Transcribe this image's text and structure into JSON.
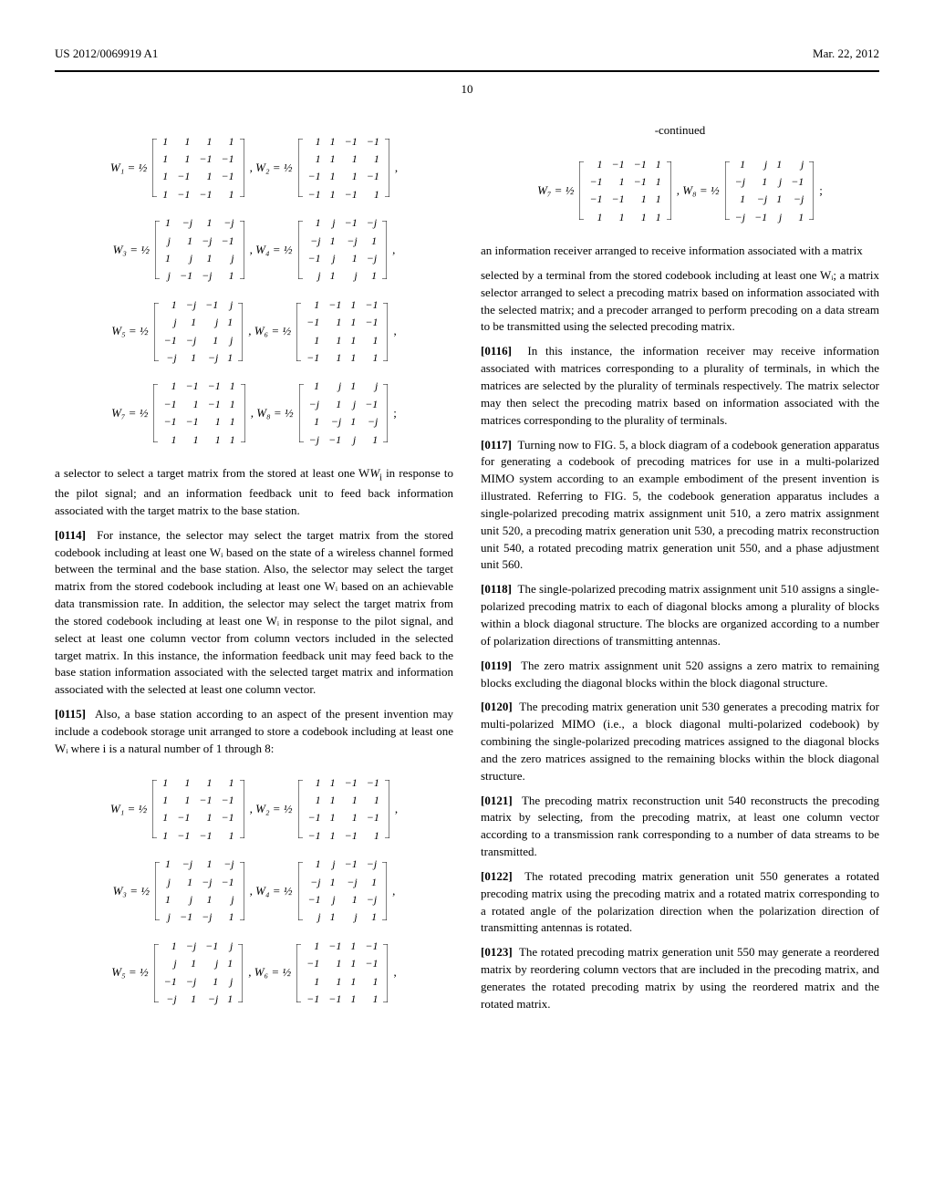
{
  "header": {
    "left": "US 2012/0069919 A1",
    "right": "Mar. 22, 2012",
    "page_number": "10"
  },
  "matrices_col1_top": [
    {
      "label": "W₁ = ½",
      "cells": [
        [
          "1",
          "1",
          "1",
          "1"
        ],
        [
          "1",
          "1",
          "−1",
          "−1"
        ],
        [
          "1",
          "−1",
          "1",
          "−1"
        ],
        [
          "1",
          "−1",
          "−1",
          "1"
        ]
      ],
      "pair_label": ", W₂ = ½",
      "pair_cells": [
        [
          "1",
          "1",
          "−1",
          "−1"
        ],
        [
          "1",
          "1",
          "1",
          "1"
        ],
        [
          "−1",
          "1",
          "1",
          "−1"
        ],
        [
          "−1",
          "1",
          "−1",
          "1"
        ]
      ],
      "trail": ","
    },
    {
      "label": "W₃ = ½",
      "cells": [
        [
          "1",
          "−j",
          "1",
          "−j"
        ],
        [
          "j",
          "1",
          "−j",
          "−1"
        ],
        [
          "1",
          "j",
          "1",
          "j"
        ],
        [
          "j",
          "−1",
          "−j",
          "1"
        ]
      ],
      "pair_label": ", W₄ = ½",
      "pair_cells": [
        [
          "1",
          "j",
          "−1",
          "−j"
        ],
        [
          "−j",
          "1",
          "−j",
          "1"
        ],
        [
          "−1",
          "j",
          "1",
          "−j"
        ],
        [
          "j",
          "1",
          "j",
          "1"
        ]
      ],
      "trail": ","
    },
    {
      "label": "W₅ = ½",
      "cells": [
        [
          "1",
          "−j",
          "−1",
          "j"
        ],
        [
          "j",
          "1",
          "j",
          "1"
        ],
        [
          "−1",
          "−j",
          "1",
          "j"
        ],
        [
          "−j",
          "1",
          "−j",
          "1"
        ]
      ],
      "pair_label": ", W₆ = ½",
      "pair_cells": [
        [
          "1",
          "−1",
          "1",
          "−1"
        ],
        [
          "−1",
          "1",
          "1",
          "−1"
        ],
        [
          "1",
          "1",
          "1",
          "1"
        ],
        [
          "−1",
          "1",
          "1",
          "1"
        ]
      ],
      "trail": ","
    },
    {
      "label": "W₇ = ½",
      "cells": [
        [
          "1",
          "−1",
          "−1",
          "1"
        ],
        [
          "−1",
          "1",
          "−1",
          "1"
        ],
        [
          "−1",
          "−1",
          "1",
          "1"
        ],
        [
          "1",
          "1",
          "1",
          "1"
        ]
      ],
      "pair_label": ", W₈ = ½",
      "pair_cells": [
        [
          "1",
          "j",
          "1",
          "j"
        ],
        [
          "−j",
          "1",
          "j",
          "−1"
        ],
        [
          "1",
          "−j",
          "1",
          "−j"
        ],
        [
          "−j",
          "−1",
          "j",
          "1"
        ]
      ],
      "trail": ";"
    }
  ],
  "matrices_col1_bottom": [
    {
      "label": "W₁ = ½",
      "cells": [
        [
          "1",
          "1",
          "1",
          "1"
        ],
        [
          "1",
          "1",
          "−1",
          "−1"
        ],
        [
          "1",
          "−1",
          "1",
          "−1"
        ],
        [
          "1",
          "−1",
          "−1",
          "1"
        ]
      ],
      "pair_label": ", W₂ = ½",
      "pair_cells": [
        [
          "1",
          "1",
          "−1",
          "−1"
        ],
        [
          "1",
          "1",
          "1",
          "1"
        ],
        [
          "−1",
          "1",
          "1",
          "−1"
        ],
        [
          "−1",
          "1",
          "−1",
          "1"
        ]
      ],
      "trail": ","
    },
    {
      "label": "W₃ = ½",
      "cells": [
        [
          "1",
          "−j",
          "1",
          "−j"
        ],
        [
          "j",
          "1",
          "−j",
          "−1"
        ],
        [
          "1",
          "j",
          "1",
          "j"
        ],
        [
          "j",
          "−1",
          "−j",
          "1"
        ]
      ],
      "pair_label": ", W₄ = ½",
      "pair_cells": [
        [
          "1",
          "j",
          "−1",
          "−j"
        ],
        [
          "−j",
          "1",
          "−j",
          "1"
        ],
        [
          "−1",
          "j",
          "1",
          "−j"
        ],
        [
          "j",
          "1",
          "j",
          "1"
        ]
      ],
      "trail": ","
    },
    {
      "label": "W₅ = ½",
      "cells": [
        [
          "1",
          "−j",
          "−1",
          "j"
        ],
        [
          "j",
          "1",
          "j",
          "1"
        ],
        [
          "−1",
          "−j",
          "1",
          "j"
        ],
        [
          "−j",
          "1",
          "−j",
          "1"
        ]
      ],
      "pair_label": ", W₆ = ½",
      "pair_cells": [
        [
          "1",
          "−1",
          "1",
          "−1"
        ],
        [
          "−1",
          "1",
          "1",
          "−1"
        ],
        [
          "1",
          "1",
          "1",
          "1"
        ],
        [
          "−1",
          "−1",
          "1",
          "1"
        ]
      ],
      "trail": ","
    }
  ],
  "col2_continued_label": "-continued",
  "matrices_col2_top": [
    {
      "label": "W₇ = ½",
      "cells": [
        [
          "1",
          "−1",
          "−1",
          "1"
        ],
        [
          "−1",
          "1",
          "−1",
          "1"
        ],
        [
          "−1",
          "−1",
          "1",
          "1"
        ],
        [
          "1",
          "1",
          "1",
          "1"
        ]
      ],
      "pair_label": ", W₈ = ½",
      "pair_cells": [
        [
          "1",
          "j",
          "1",
          "j"
        ],
        [
          "−j",
          "1",
          "j",
          "−1"
        ],
        [
          "1",
          "−j",
          "1",
          "−j"
        ],
        [
          "−j",
          "−1",
          "j",
          "1"
        ]
      ],
      "trail": ";"
    }
  ],
  "paras_col1": [
    {
      "text_before_num": "a selector to select a target matrix from the stored at least one W",
      "sub": "i",
      "text_after": " in response to the pilot signal; and an information feedback unit to feed back information associated with the target matrix to the base station."
    },
    {
      "num": "[0114]",
      "text": "For instance, the selector may select the target matrix from the stored codebook including at least one Wᵢ based on the state of a wireless channel formed between the terminal and the base station. Also, the selector may select the target matrix from the stored codebook including at least one Wᵢ based on an achievable data transmission rate. In addition, the selector may select the target matrix from the stored codebook including at least one Wᵢ in response to the pilot signal, and select at least one column vector from column vectors included in the selected target matrix. In this instance, the information feedback unit may feed back to the base station information associated with the selected target matrix and information associated with the selected at least one column vector."
    },
    {
      "num": "[0115]",
      "text": "Also, a base station according to an aspect of the present invention may include a codebook storage unit arranged to store a codebook including at least one Wᵢ where i is a natural number of 1 through 8:"
    }
  ],
  "paras_col2": [
    {
      "text": "an information receiver arranged to receive information associated with a matrix"
    },
    {
      "text": "selected by a terminal from the stored codebook including at least one Wᵢ; a matrix selector arranged to select a precoding matrix based on information associated with the selected matrix; and a precoder arranged to perform precoding on a data stream to be transmitted using the selected precoding matrix."
    },
    {
      "num": "[0116]",
      "text": "In this instance, the information receiver may receive information associated with matrices corresponding to a plurality of terminals, in which the matrices are selected by the plurality of terminals respectively. The matrix selector may then select the precoding matrix based on information associated with the matrices corresponding to the plurality of terminals."
    },
    {
      "num": "[0117]",
      "text": "Turning now to FIG. 5, a block diagram of a codebook generation apparatus for generating a codebook of precoding matrices for use in a multi-polarized MIMO system according to an example embodiment of the present invention is illustrated. Referring to FIG. 5, the codebook generation apparatus includes a single-polarized precoding matrix assignment unit 510, a zero matrix assignment unit 520, a precoding matrix generation unit 530, a precoding matrix reconstruction unit 540, a rotated precoding matrix generation unit 550, and a phase adjustment unit 560."
    },
    {
      "num": "[0118]",
      "text": "The single-polarized precoding matrix assignment unit 510 assigns a single-polarized precoding matrix to each of diagonal blocks among a plurality of blocks within a block diagonal structure. The blocks are organized according to a number of polarization directions of transmitting antennas."
    },
    {
      "num": "[0119]",
      "text": "The zero matrix assignment unit 520 assigns a zero matrix to remaining blocks excluding the diagonal blocks within the block diagonal structure."
    },
    {
      "num": "[0120]",
      "text": "The precoding matrix generation unit 530 generates a precoding matrix for multi-polarized MIMO (i.e., a block diagonal multi-polarized codebook) by combining the single-polarized precoding matrices assigned to the diagonal blocks and the zero matrices assigned to the remaining blocks within the block diagonal structure."
    },
    {
      "num": "[0121]",
      "text": "The precoding matrix reconstruction unit 540 reconstructs the precoding matrix by selecting, from the precoding matrix, at least one column vector according to a transmission rank corresponding to a number of data streams to be transmitted."
    },
    {
      "num": "[0122]",
      "text": "The rotated precoding matrix generation unit 550 generates a rotated precoding matrix using the precoding matrix and a rotated matrix corresponding to a rotated angle of the polarization direction when the polarization direction of transmitting antennas is rotated."
    },
    {
      "num": "[0123]",
      "text": "The rotated precoding matrix generation unit 550 may generate a reordered matrix by reordering column vectors that are included in the precoding matrix, and generates the rotated precoding matrix by using the reordered matrix and the rotated matrix."
    }
  ]
}
